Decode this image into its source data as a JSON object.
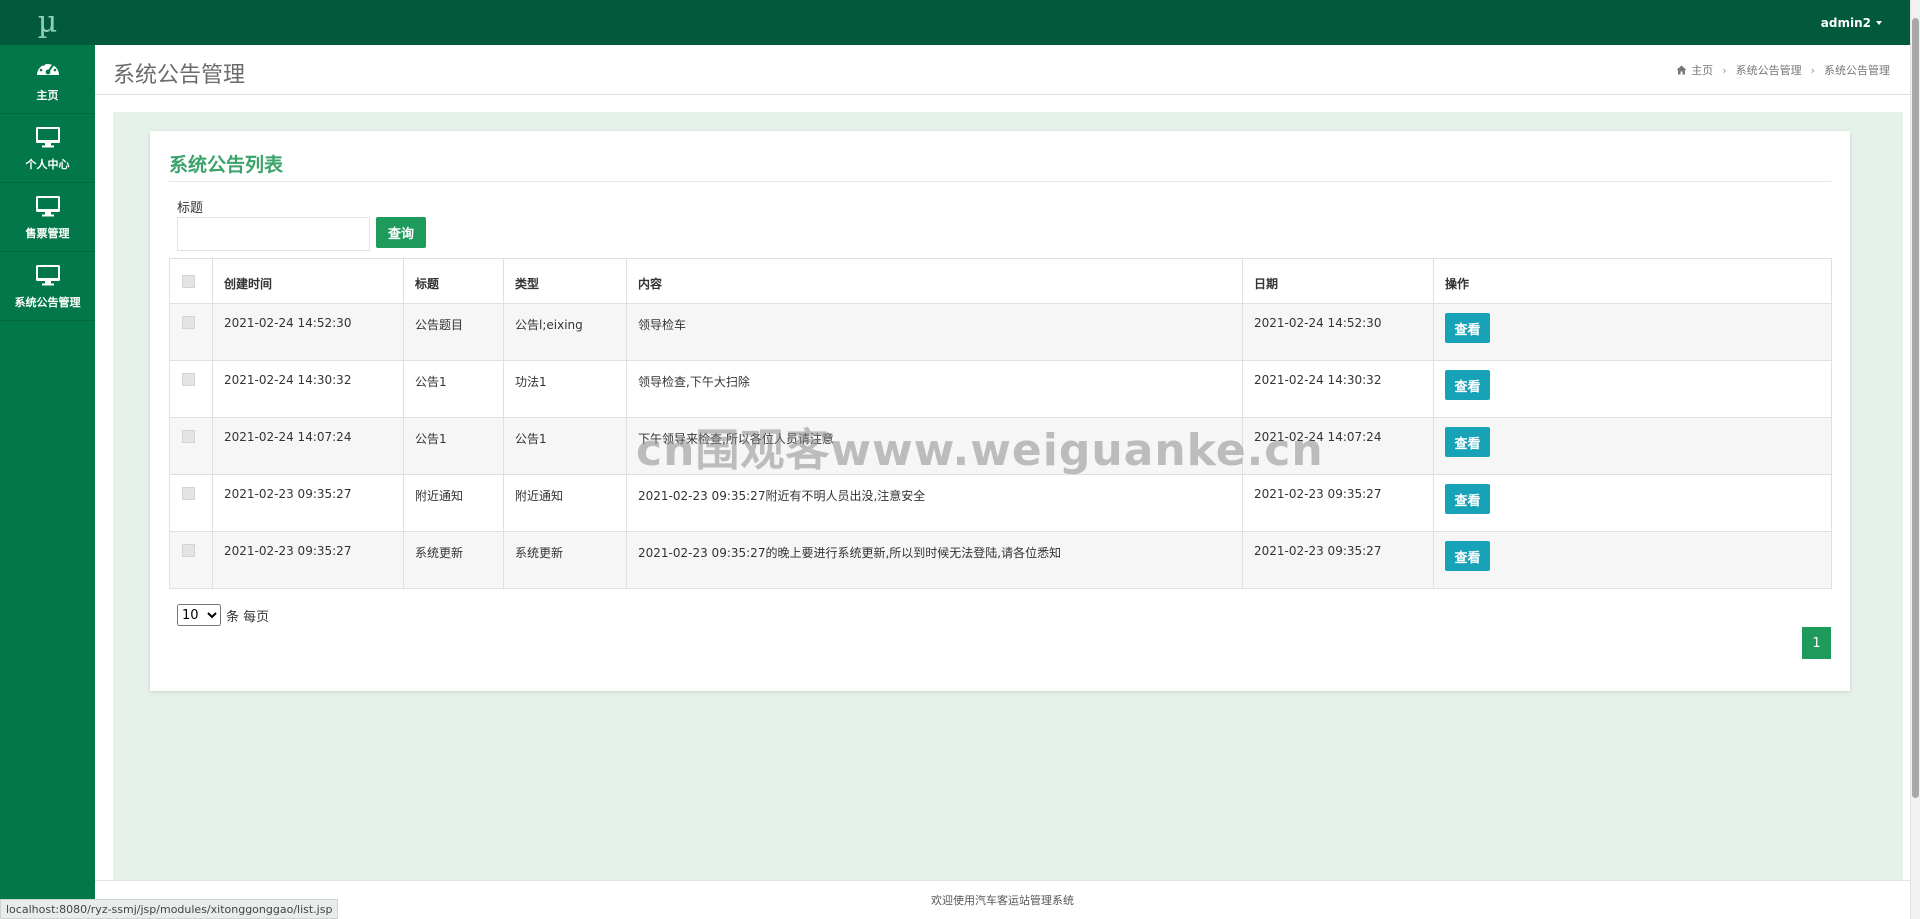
{
  "app": {
    "logo": "µ",
    "user_menu": "admin2"
  },
  "sidebar": {
    "items": [
      {
        "label": "主页",
        "icon": "dashboard-icon"
      },
      {
        "label": "个人中心",
        "icon": "monitor-icon"
      },
      {
        "label": "售票管理",
        "icon": "monitor-icon"
      },
      {
        "label": "系统公告管理",
        "icon": "monitor-icon"
      }
    ]
  },
  "header": {
    "page_title": "系统公告管理",
    "breadcrumb": [
      "主页",
      "系统公告管理",
      "系统公告管理"
    ]
  },
  "card": {
    "title": "系统公告列表",
    "search": {
      "label": "标题",
      "value": "",
      "button": "查询"
    },
    "table": {
      "headers": [
        "创建时间",
        "标题",
        "类型",
        "内容",
        "日期",
        "操作"
      ],
      "rows": [
        {
          "created": "2021-02-24 14:52:30",
          "title": "公告题目",
          "type": "公告l;eixing",
          "content": "领导检车",
          "date": "2021-02-24 14:52:30",
          "action": "查看"
        },
        {
          "created": "2021-02-24 14:30:32",
          "title": "公告1",
          "type": "功法1",
          "content": "领导检查,下午大扫除",
          "date": "2021-02-24 14:30:32",
          "action": "查看"
        },
        {
          "created": "2021-02-24 14:07:24",
          "title": "公告1",
          "type": "公告1",
          "content": "下午领导来检查,所以各位人员请注意",
          "date": "2021-02-24 14:07:24",
          "action": "查看"
        },
        {
          "created": "2021-02-23 09:35:27",
          "title": "附近通知",
          "type": "附近通知",
          "content": "2021-02-23 09:35:27附近有不明人员出没,注意安全",
          "date": "2021-02-23 09:35:27",
          "action": "查看"
        },
        {
          "created": "2021-02-23 09:35:27",
          "title": "系统更新",
          "type": "系统更新",
          "content": "2021-02-23 09:35:27的晚上要进行系统更新,所以到时候无法登陆,请各位悉知",
          "date": "2021-02-23 09:35:27",
          "action": "查看"
        }
      ]
    },
    "pagination": {
      "page_size": "10",
      "page_size_suffix": "条 每页",
      "current_page": "1"
    }
  },
  "footer": {
    "text": "欢迎使用汽车客运站管理系统"
  },
  "status_bar": {
    "url": "localhost:8080/ryz-ssmj/jsp/modules/xitonggonggao/list.jsp"
  },
  "watermark": "cn围观客www.weiguanke.cn",
  "colors": {
    "sidebar": "#01774a",
    "topbar": "#015a3c",
    "accent": "#1e9a5a",
    "info_button": "#17a2b8",
    "card_title": "#3aa36a"
  }
}
